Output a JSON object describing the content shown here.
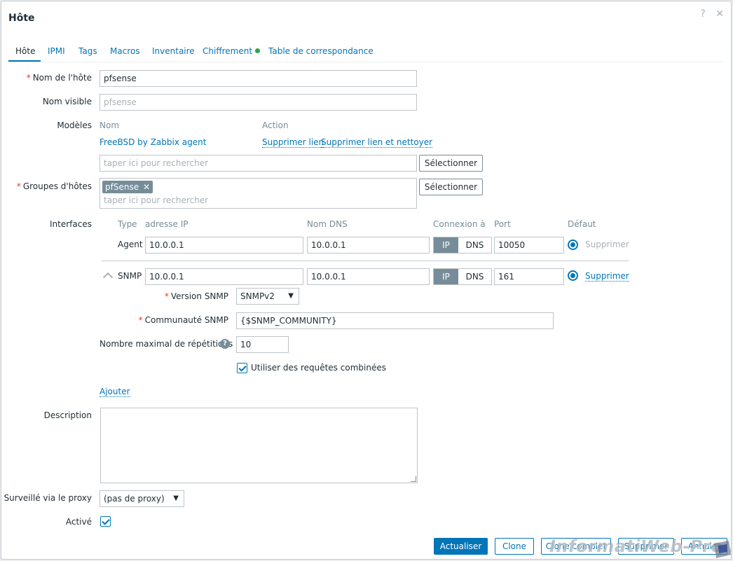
{
  "dialog": {
    "title": "Hôte",
    "help_glyph": "?",
    "close_glyph": "✕"
  },
  "tabs": [
    {
      "label": "Hôte",
      "active": true
    },
    {
      "label": "IPMI"
    },
    {
      "label": "Tags"
    },
    {
      "label": "Macros"
    },
    {
      "label": "Inventaire"
    },
    {
      "label": "Chiffrement"
    },
    {
      "label": "Table de correspondance"
    }
  ],
  "form": {
    "required_mark": "*",
    "host_name": {
      "label": "Nom de l'hôte",
      "value": "pfsense"
    },
    "visible_name": {
      "label": "Nom visible",
      "placeholder": "pfsense"
    },
    "templates": {
      "label": "Modèles",
      "col_name": "Nom",
      "col_action": "Action",
      "items": [
        {
          "name": "FreeBSD by Zabbix agent",
          "unlink": "Supprimer lien",
          "unlink_clear": "Supprimer lien et nettoyer"
        }
      ],
      "search_placeholder": "taper ici pour rechercher",
      "select_button": "Sélectionner"
    },
    "host_groups": {
      "label": "Groupes d'hôtes",
      "chips": [
        {
          "label": "pfSense",
          "remove": "✕"
        }
      ],
      "search_placeholder": "taper ici pour rechercher",
      "select_button": "Sélectionner"
    },
    "interfaces": {
      "label": "Interfaces",
      "headers": {
        "type": "Type",
        "ip": "adresse IP",
        "dns": "Nom DNS",
        "connect": "Connexion à",
        "port": "Port",
        "default": "Défaut"
      },
      "rows": [
        {
          "type": "Agent",
          "ip": "10.0.0.1",
          "dns": "10.0.0.1",
          "ip_btn": "IP",
          "dns_btn": "DNS",
          "port": "10050",
          "remove": "Supprimer"
        },
        {
          "type": "SNMP",
          "ip": "10.0.0.1",
          "dns": "10.0.0.1",
          "ip_btn": "IP",
          "dns_btn": "DNS",
          "port": "161",
          "remove": "Supprimer"
        }
      ],
      "snmp": {
        "version_label": "Version SNMP",
        "version_value": "SNMPv2",
        "community_label": "Communauté SNMP",
        "community_value": "{$SNMP_COMMUNITY}",
        "max_rep_label": "Nombre maximal de répétitions",
        "max_rep_help": "?",
        "max_rep_value": "10",
        "bulk_label": "Utiliser des requêtes combinées",
        "bulk_checked": true
      },
      "add_link": "Ajouter"
    },
    "description": {
      "label": "Description",
      "value": ""
    },
    "proxy": {
      "label": "Surveillé via le proxy",
      "value": "(pas de proxy)"
    },
    "enabled": {
      "label": "Activé",
      "checked": true
    }
  },
  "footer": {
    "update": "Actualiser",
    "clone": "Clone",
    "full_clone": "Clone complet",
    "delete": "Supprimer",
    "cancel": "Annuler"
  },
  "watermark": {
    "text": "InformatiWeb-Pro.net"
  },
  "colors": {
    "accent": "#0275b8",
    "required": "#e33734",
    "status_ok": "#2ba644",
    "chip": "#768d99"
  }
}
